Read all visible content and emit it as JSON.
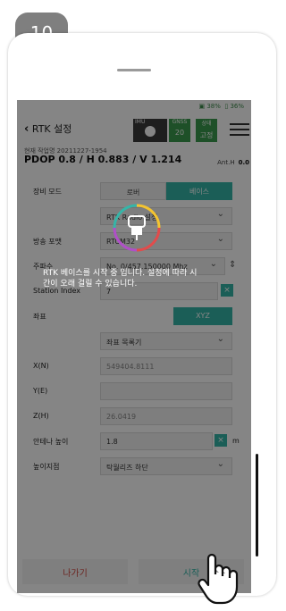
{
  "step_number": "10",
  "status": {
    "battery1": "38%",
    "battery2": "36%"
  },
  "header": {
    "back_label": "RTK 설정",
    "imu_label": "IMU",
    "gnss_label": "GNSS",
    "gnss_value": "20",
    "state_label": "상태",
    "state_value": "고정"
  },
  "info": {
    "project": "현재 작업명 20211227-1954",
    "precision": "PDOP 0.8 / H 0.883 / V 1.214",
    "ant_label": "Ant.H",
    "ant_value": "0.0"
  },
  "form": {
    "equip_mode_label": "장비 모드",
    "mode_rover": "로버",
    "mode_base": "베이스",
    "radio_setting": "RTK Radio 설정",
    "broadcast_label": "방송 포맷",
    "broadcast_value": "RTCM32",
    "frequency_label": "주파수",
    "frequency_value": "No. 0/457.150000 Mhz",
    "station_label": "Station Index",
    "station_value": "7",
    "coord_label": "좌표",
    "coord_xyz": "XYZ",
    "coord_select": "좌표 목록기",
    "x_label": "X(N)",
    "x_value": "549404.8111",
    "y_label": "Y(E)",
    "z_label": "Z(H)",
    "z_value": "26.0419",
    "ant_height_label": "안테나 높이",
    "ant_height_value": "1.8",
    "ant_height_unit": "m",
    "height_point_label": "높이지점",
    "height_point_value": "탁월리즈 하단"
  },
  "toast_message": "RTK 베이스를 시작 중 입니다. 설정에 따라 시간이 오래 걸릴 수 있습니다.",
  "buttons": {
    "exit": "나가기",
    "start": "시작"
  },
  "colors": {
    "teal": "#35b5a8",
    "green": "#3b8a4a",
    "exit_red": "#cf4a42"
  }
}
